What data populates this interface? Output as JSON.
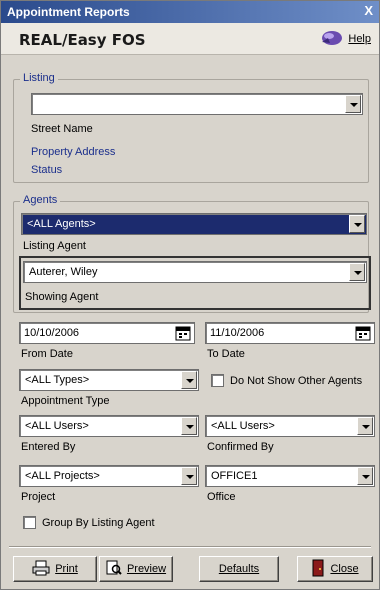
{
  "window": {
    "title": "Appointment Reports",
    "close_glyph": "X"
  },
  "header": {
    "app_name": "REAL/Easy FOS",
    "help_label": "Help",
    "help_icon": "help-icon"
  },
  "listing": {
    "legend": "Listing",
    "value": "",
    "street_name_label": "Street Name",
    "property_address_label": "Property Address",
    "status_label": "Status"
  },
  "agents": {
    "legend": "Agents",
    "listing_agent_value": "<ALL Agents>",
    "listing_agent_label": "Listing Agent",
    "showing_agent_value": "Auterer, Wiley",
    "showing_agent_label": "Showing Agent"
  },
  "dates": {
    "from_value": "10/10/2006",
    "from_label": "From Date",
    "to_value": "11/10/2006",
    "to_label": "To Date"
  },
  "filters": {
    "appointment_type_value": "<ALL Types>",
    "appointment_type_label": "Appointment Type",
    "do_not_show_label": "Do Not Show Other Agents",
    "entered_by_value": "<ALL Users>",
    "entered_by_label": "Entered By",
    "confirmed_by_value": "<ALL Users>",
    "confirmed_by_label": "Confirmed By",
    "project_value": "<ALL Projects>",
    "project_label": "Project",
    "office_value": "OFFICE1",
    "office_label": "Office",
    "group_by_label": "Group By Listing Agent"
  },
  "buttons": {
    "print": "Print",
    "preview": "Preview",
    "defaults": "Defaults",
    "close": "Close"
  },
  "colors": {
    "title_bar": "#2a4a8c",
    "selection": "#1c2b6e",
    "link": "#1b2f8c",
    "face": "#d8d4cc"
  }
}
